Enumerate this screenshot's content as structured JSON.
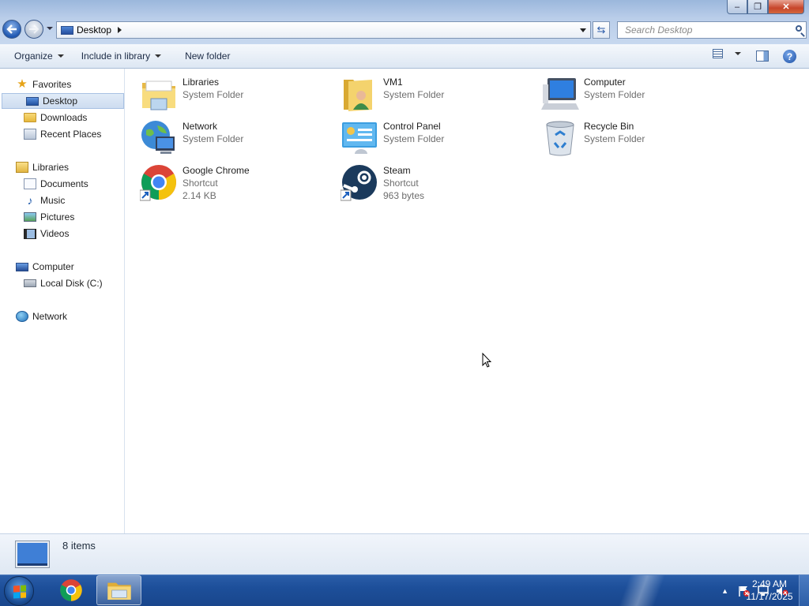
{
  "window": {
    "controls": {
      "minimize": "–",
      "maximize": "❐",
      "close": "✕"
    }
  },
  "address": {
    "breadcrumb": "Desktop",
    "search_placeholder": "Search Desktop"
  },
  "commands": {
    "organize": "Organize",
    "include_in_library": "Include in library",
    "new_folder": "New folder",
    "help": "?"
  },
  "nav": {
    "favorites": "Favorites",
    "desktop": "Desktop",
    "downloads": "Downloads",
    "recent_places": "Recent Places",
    "libraries": "Libraries",
    "documents": "Documents",
    "music": "Music",
    "pictures": "Pictures",
    "videos": "Videos",
    "computer": "Computer",
    "local_disk": "Local Disk (C:)",
    "network": "Network"
  },
  "items": [
    {
      "name": "Libraries",
      "type": "System Folder",
      "icon": "libraries-icon"
    },
    {
      "name": "VM1",
      "type": "System Folder",
      "icon": "user-folder-icon"
    },
    {
      "name": "Computer",
      "type": "System Folder",
      "icon": "computer-icon"
    },
    {
      "name": "Network",
      "type": "System Folder",
      "icon": "network-icon"
    },
    {
      "name": "Control Panel",
      "type": "System Folder",
      "icon": "control-panel-icon"
    },
    {
      "name": "Recycle Bin",
      "type": "System Folder",
      "icon": "recycle-bin-icon"
    },
    {
      "name": "Google Chrome",
      "type": "Shortcut",
      "size": "2.14 KB",
      "icon": "chrome-icon"
    },
    {
      "name": "Steam",
      "type": "Shortcut",
      "size": "963 bytes",
      "icon": "steam-icon"
    }
  ],
  "details": {
    "count": "8 items"
  },
  "taskbar": {
    "time": "2:49 AM",
    "date": "11/17/2025"
  },
  "colors": {
    "taskbar": "#1d4f9a",
    "selection": "#cddcf0",
    "secondary_text": "#6d6d6d"
  }
}
